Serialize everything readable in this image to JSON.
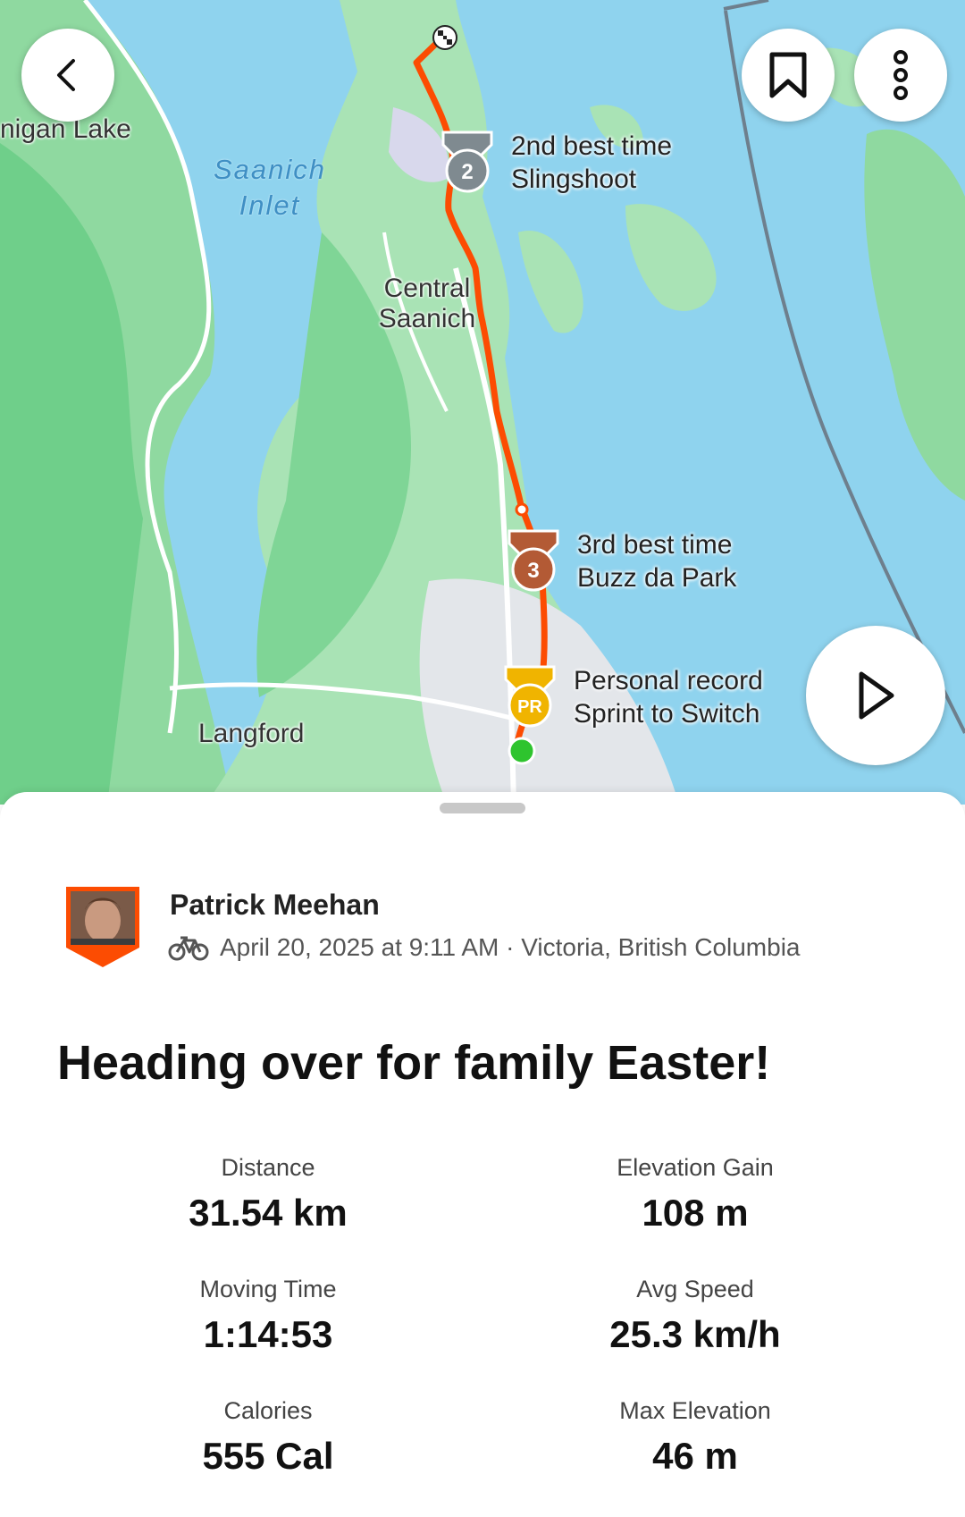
{
  "map": {
    "places": {
      "lake": "nigan Lake",
      "inlet": "Saanich Inlet",
      "central": "Central Saanich",
      "langford": "Langford"
    },
    "segments": [
      {
        "rank_label": "2nd best time",
        "name": "Slingshoot",
        "badge": "2",
        "color": "#7f8a90"
      },
      {
        "rank_label": "3rd best time",
        "name": "Buzz da Park",
        "badge": "3",
        "color": "#b35a35"
      },
      {
        "rank_label": "Personal record",
        "name": "Sprint to Switch",
        "badge": "PR",
        "color": "#f0b400"
      }
    ],
    "route_color": "#fc4c02",
    "start_color": "#2ec42e"
  },
  "buttons": {
    "back_icon": "chevron-left-icon",
    "bookmark_icon": "bookmark-icon",
    "more_icon": "more-vertical-icon",
    "play_icon": "play-icon"
  },
  "activity": {
    "athlete": "Patrick Meehan",
    "sport_icon": "bicycle-icon",
    "date_location": "April 20, 2025 at 9:11 AM · Victoria, British Columbia",
    "title": "Heading over for family Easter!",
    "stats": [
      {
        "label": "Distance",
        "value": "31.54 km"
      },
      {
        "label": "Elevation Gain",
        "value": "108 m"
      },
      {
        "label": "Moving Time",
        "value": "1:14:53"
      },
      {
        "label": "Avg Speed",
        "value": "25.3 km/h"
      },
      {
        "label": "Calories",
        "value": "555 Cal"
      },
      {
        "label": "Max Elevation",
        "value": "46 m"
      }
    ]
  }
}
